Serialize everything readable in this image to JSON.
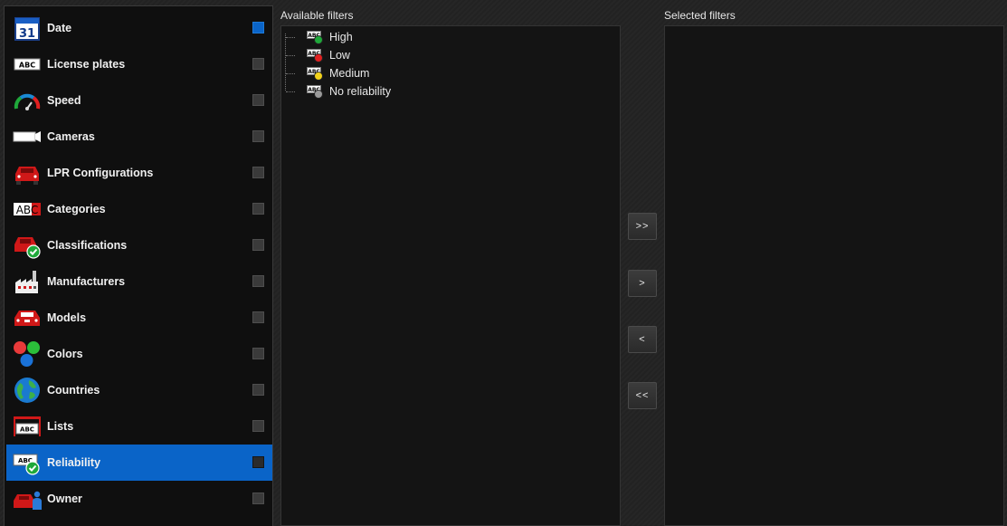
{
  "left_panel": {
    "items": [
      {
        "label": "Date",
        "icon": "calendar-icon",
        "icon_text": "31",
        "checked": true
      },
      {
        "label": "License plates",
        "icon": "license-plate-icon",
        "icon_text": "ABC",
        "checked": false
      },
      {
        "label": "Speed",
        "icon": "speedometer-icon",
        "checked": false
      },
      {
        "label": "Cameras",
        "icon": "camera-icon",
        "checked": false
      },
      {
        "label": "LPR Configurations",
        "icon": "red-car-icon",
        "checked": false
      },
      {
        "label": "Categories",
        "icon": "abc-category-icon",
        "icon_text": "ABC",
        "checked": false
      },
      {
        "label": "Classifications",
        "icon": "car-check-icon",
        "checked": false
      },
      {
        "label": "Manufacturers",
        "icon": "factory-icon",
        "checked": false
      },
      {
        "label": "Models",
        "icon": "car-model-icon",
        "checked": false
      },
      {
        "label": "Colors",
        "icon": "colors-icon",
        "checked": false
      },
      {
        "label": "Countries",
        "icon": "globe-icon",
        "checked": false
      },
      {
        "label": "Lists",
        "icon": "lists-icon",
        "icon_text": "ABC",
        "checked": false
      },
      {
        "label": "Reliability",
        "icon": "reliability-icon",
        "icon_text": "ABC",
        "checked": false,
        "selected": true
      },
      {
        "label": "Owner",
        "icon": "owner-icon",
        "checked": false
      }
    ]
  },
  "available": {
    "title": "Available filters",
    "items": [
      {
        "label": "High",
        "icon": "high-reliability-icon",
        "color": "#1fa83a"
      },
      {
        "label": "Low",
        "icon": "low-reliability-icon",
        "color": "#e02020"
      },
      {
        "label": "Medium",
        "icon": "medium-reliability-icon",
        "color": "#f2d21b"
      },
      {
        "label": "No reliability",
        "icon": "no-reliability-icon",
        "color": "#9a9a9a"
      }
    ],
    "abc_text": "ABC"
  },
  "selected": {
    "title": "Selected filters"
  },
  "buttons": {
    "add_all": ">>",
    "add": ">",
    "remove": "<",
    "remove_all": "<<"
  },
  "colors": {
    "accent": "#0a64c8",
    "panel_bg": "#0f0f0f",
    "list_bg": "#141414"
  }
}
